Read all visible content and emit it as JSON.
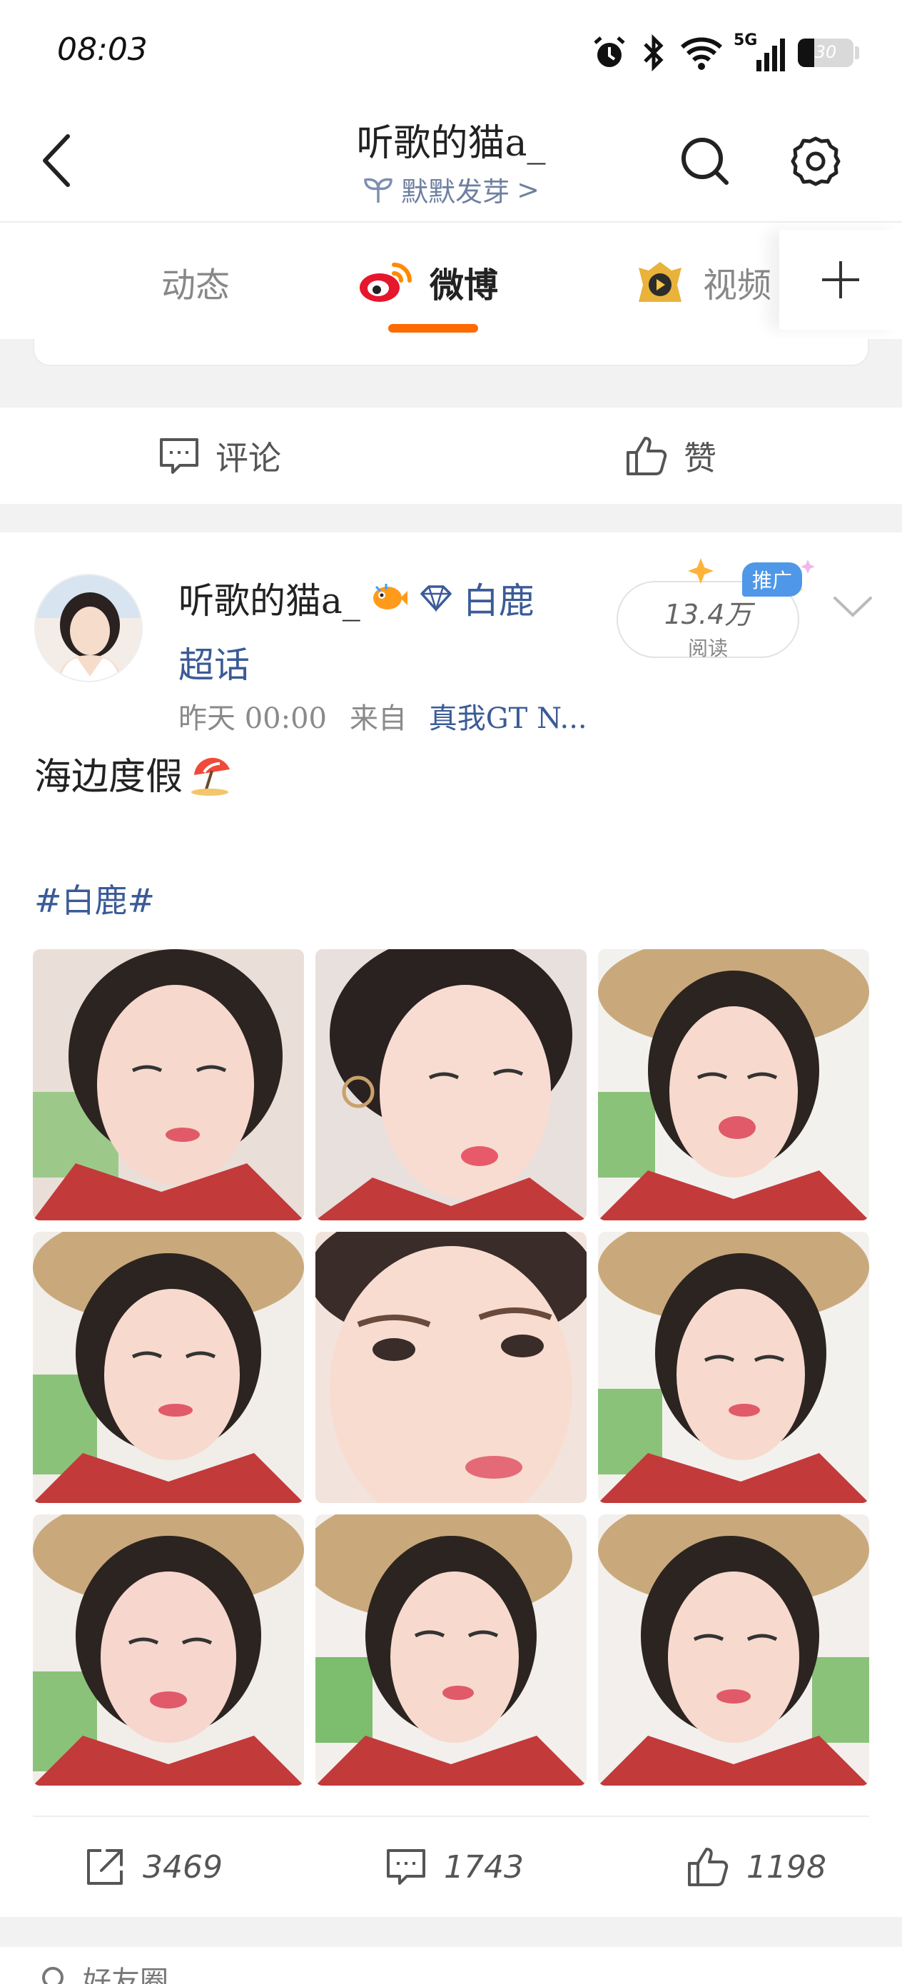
{
  "status_bar": {
    "time": "08:03",
    "network": "5G",
    "battery": "30",
    "battery_level": 0.3
  },
  "header": {
    "title": "听歌的猫a_",
    "subtitle": "默默发芽",
    "subtitle_chevron": ">"
  },
  "tabs": [
    {
      "label": "动态",
      "active": false
    },
    {
      "label": "微博",
      "active": true
    },
    {
      "label": "视频",
      "active": false
    }
  ],
  "prev_post_actions": {
    "comment_label": "评论",
    "like_label": "赞"
  },
  "post": {
    "author": "听歌的猫a_",
    "topic": "白鹿",
    "topic_suffix": "超话",
    "time": "昨天 00:00",
    "source_prefix": "来自",
    "source": "真我GT N...",
    "views": "13.4万",
    "views_label": "阅读",
    "promo_label": "推广",
    "text": "海边度假",
    "hashtag": "#白鹿#",
    "repost_count": "3469",
    "comment_count": "1743",
    "like_count": "1198"
  },
  "next_hint": {
    "label": "好友圈"
  },
  "colors": {
    "accent": "#ff6a00",
    "link": "#3b5b97",
    "promo": "#4f98e8",
    "gray_band": "#f2f2f2"
  }
}
